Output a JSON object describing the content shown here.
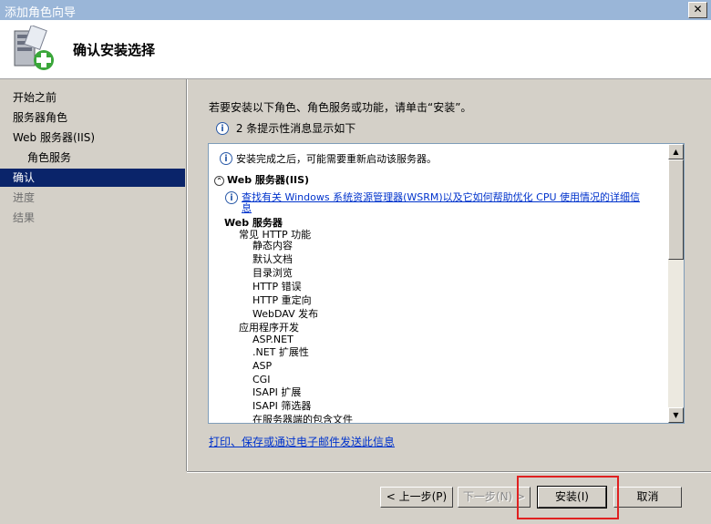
{
  "window": {
    "title": "添加角色向导",
    "close_glyph": "✕"
  },
  "header": {
    "title": "确认安装选择",
    "icon": "server-add-icon"
  },
  "sidebar": {
    "items": [
      {
        "label": "开始之前"
      },
      {
        "label": "服务器角色"
      },
      {
        "label": "Web 服务器(IIS)"
      },
      {
        "label": "角色服务"
      },
      {
        "label": "确认"
      },
      {
        "label": "进度"
      },
      {
        "label": "结果"
      }
    ]
  },
  "main": {
    "instruction": "若要安装以下角色、角色服务或功能，请单击“安装”。",
    "info_text": "2 条提示性消息显示如下",
    "info_glyph": "i",
    "list": {
      "lines": [
        "安装完成之后，可能需要重新启动该服务器。",
        "Web 服务器(IIS)",
        "查找有关 Windows 系统资源管理器(WSRM)以及它如何帮助优化 CPU 使用情况的详细信",
        "息",
        "Web 服务器",
        "常见 HTTP 功能",
        "静态内容",
        "默认文档",
        "目录浏览",
        "HTTP 错误",
        "HTTP 重定向",
        "WebDAV 发布",
        "应用程序开发",
        "ASP.NET",
        ".NET 扩展性",
        "ASP",
        "CGI",
        "ISAPI 扩展",
        "ISAPI 筛选器",
        "在服务器端的包含文件"
      ],
      "collapse_glyph": "⌃"
    },
    "print_link": "打印、保存或通过电子邮件发送此信息"
  },
  "buttons": {
    "prev": "< 上一步(P)",
    "next": "下一步(N) >",
    "install": "安装(I)",
    "cancel": "取消"
  },
  "scroll": {
    "up_glyph": "▲",
    "down_glyph": "▼"
  },
  "colors": {
    "selection": "#0a246a",
    "link": "#0033cc",
    "highlight": "#e02020"
  }
}
